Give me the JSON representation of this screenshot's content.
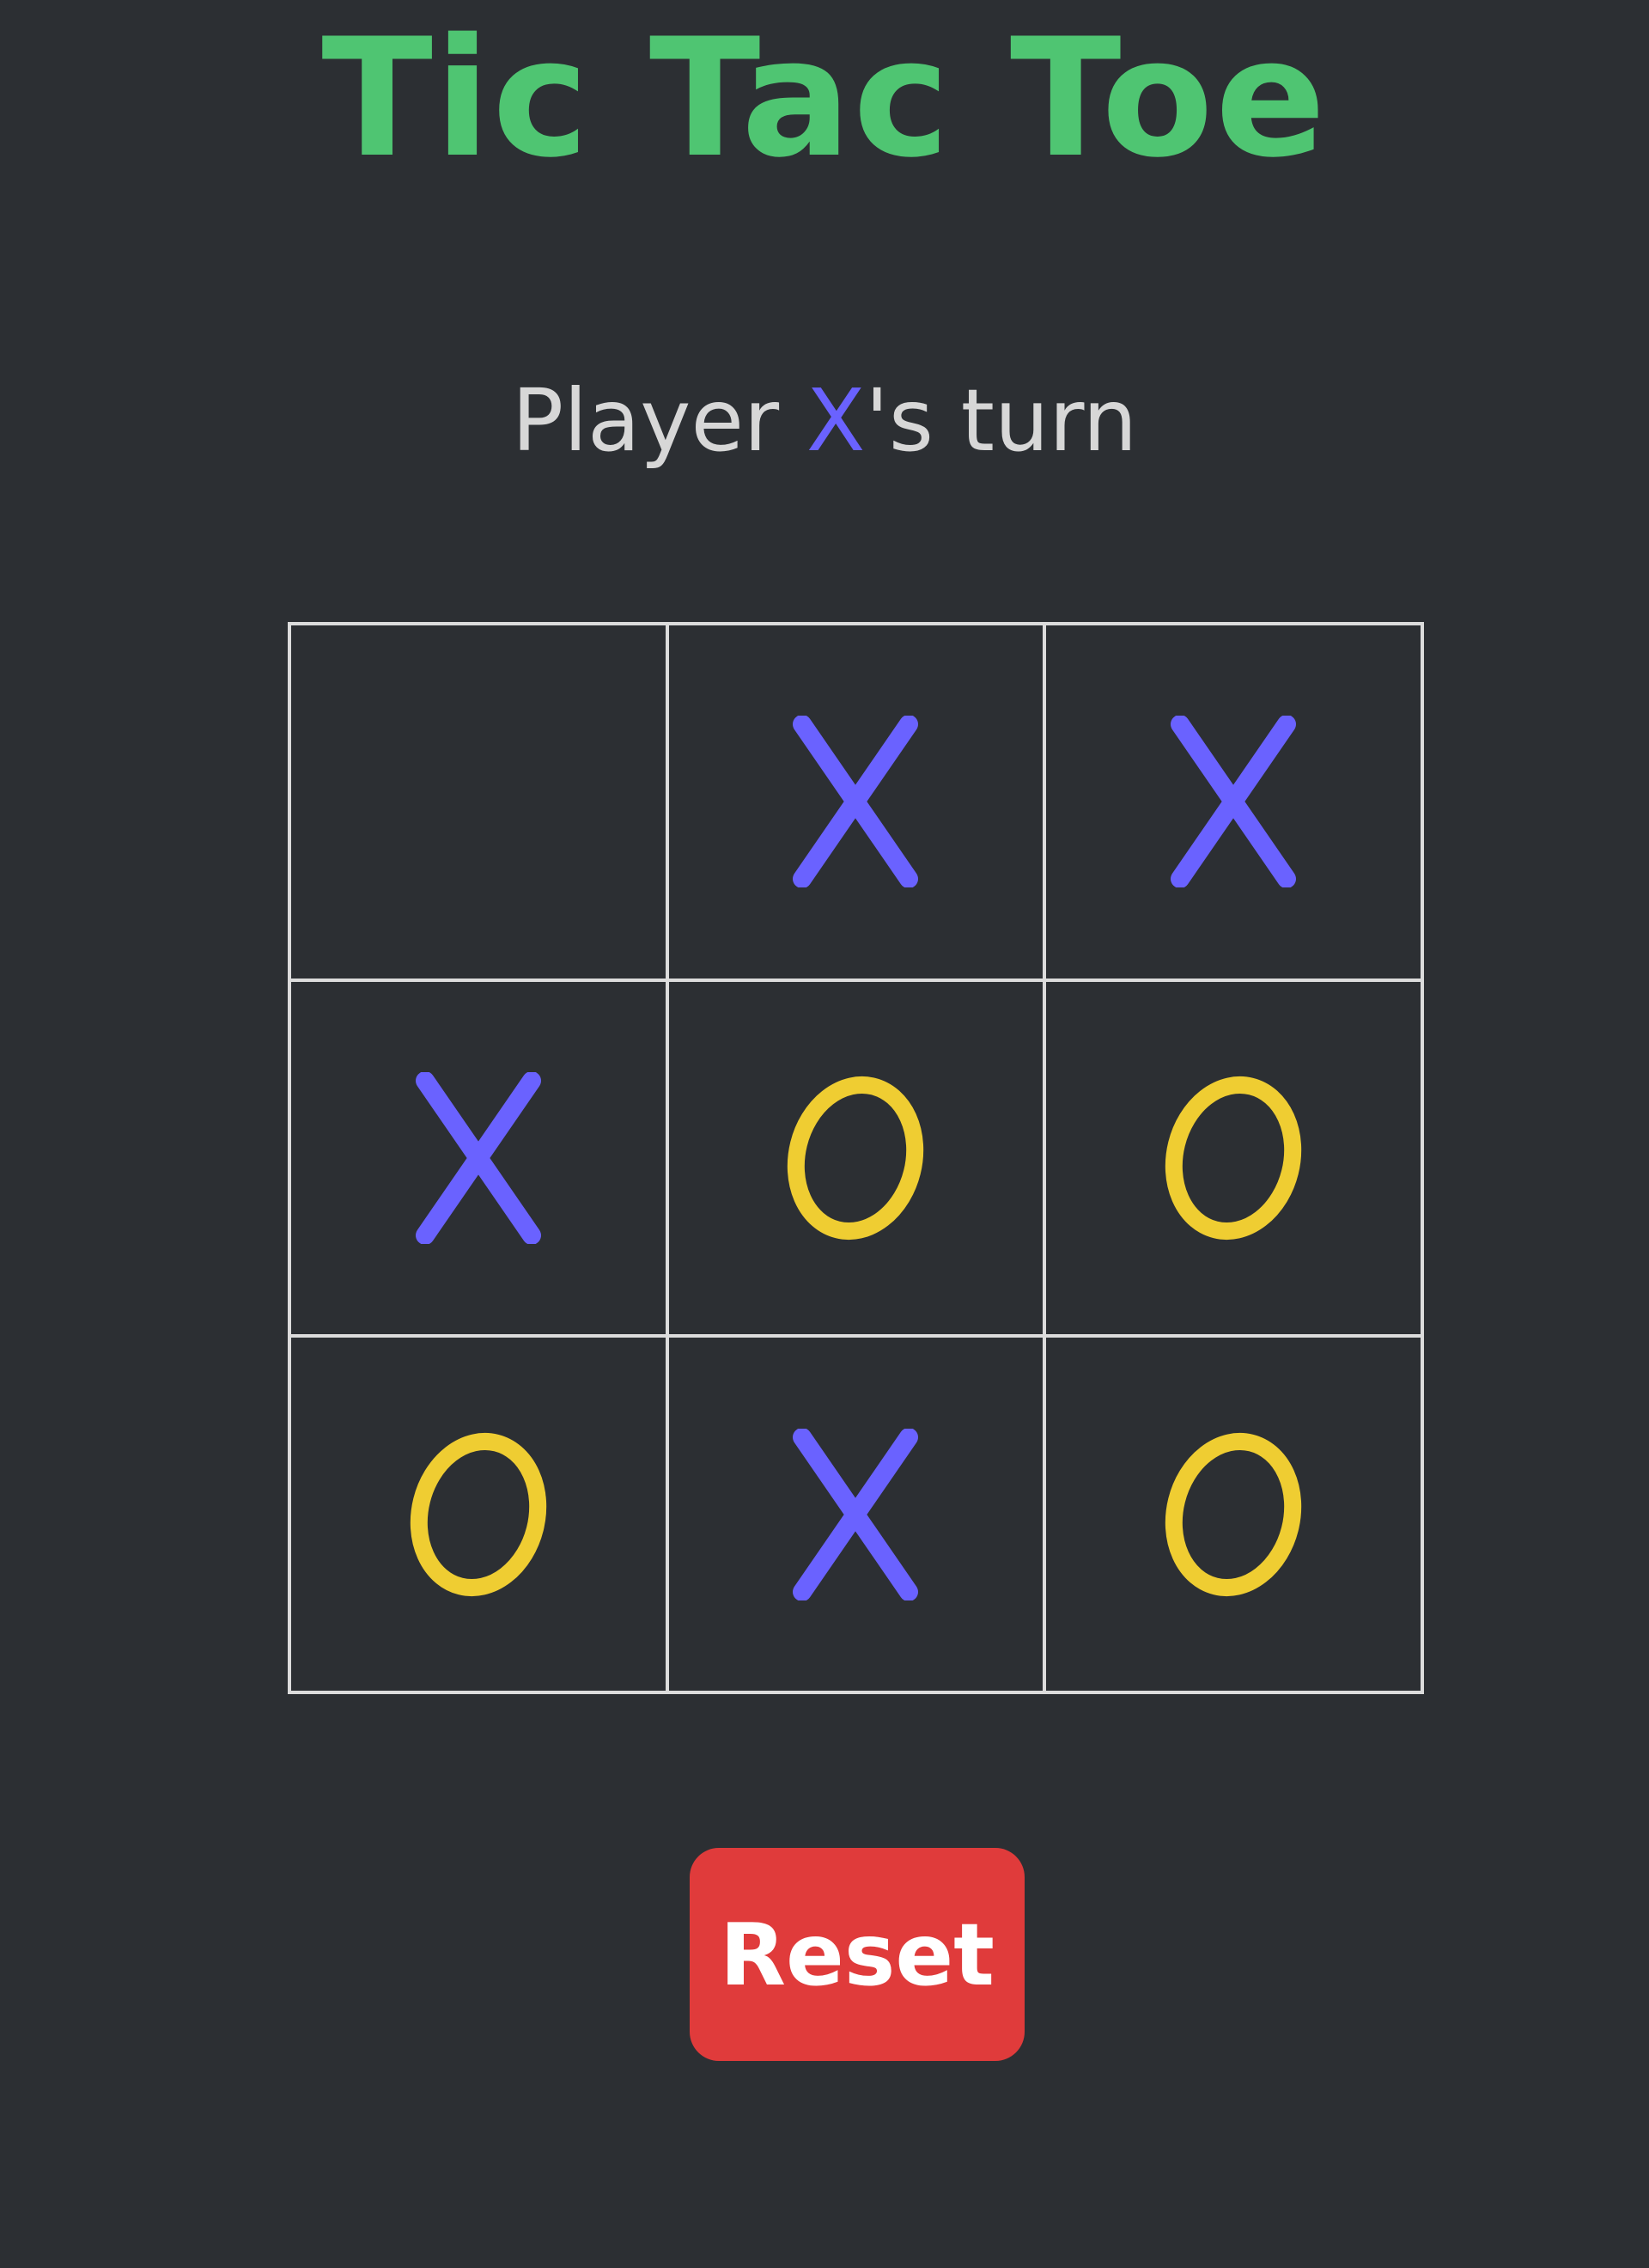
{
  "title": "Tic Tac Toe",
  "status": {
    "prefix": "Player ",
    "current_player": "X",
    "suffix": "'s turn"
  },
  "board": {
    "cells": [
      "",
      "X",
      "X",
      "X",
      "O",
      "O",
      "O",
      "X",
      "O"
    ]
  },
  "reset_label": "Reset",
  "colors": {
    "background": "#2c2f33",
    "title": "#4fc572",
    "status_text": "#d7d7d7",
    "x_mark": "#6a62ff",
    "o_mark": "#efcd32",
    "grid_line": "#dcdcdc",
    "reset_button": "#e03b3b"
  }
}
